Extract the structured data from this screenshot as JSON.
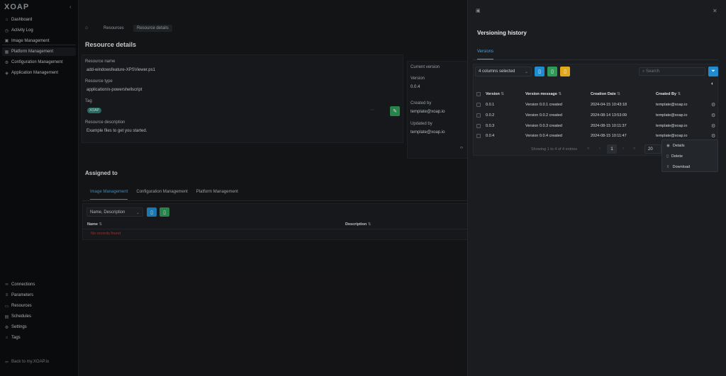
{
  "brand": {
    "logo": "XOAP"
  },
  "sidebar": {
    "items": [
      {
        "label": "Dashboard",
        "icon": "home-icon"
      },
      {
        "label": "Activity Log",
        "icon": "clock-icon"
      },
      {
        "label": "Image Management",
        "icon": "image-icon"
      },
      {
        "label": "Platform Management",
        "icon": "grid-icon"
      },
      {
        "label": "Configuration Management",
        "icon": "sliders-icon"
      },
      {
        "label": "Application Management",
        "icon": "app-icon"
      }
    ],
    "bottom": [
      {
        "label": "Connections",
        "icon": "link-icon"
      },
      {
        "label": "Parameters",
        "icon": "list-icon"
      },
      {
        "label": "Resources",
        "icon": "folder-icon"
      },
      {
        "label": "Schedules",
        "icon": "calendar-icon"
      },
      {
        "label": "Settings",
        "icon": "gear-icon"
      },
      {
        "label": "Tags",
        "icon": "tag-icon"
      }
    ],
    "back": "Back to my.XOAP.io"
  },
  "breadcrumb": {
    "items": [
      "Resources",
      "Resource details"
    ]
  },
  "details": {
    "title": "Resource details",
    "name_label": "Resource name",
    "name_value": "add-windowsfeature-XPSViewer.ps1",
    "type_label": "Resource type",
    "type_value": "application/x-powershellscript",
    "tag_label": "Tag",
    "tag_value": "XOAP",
    "desc_label": "Resource description",
    "desc_value": "Example files to get you started."
  },
  "version_card": {
    "current_label": "Current version",
    "version_label": "Version",
    "version_value": "0.0.4",
    "created_label": "Created by",
    "created_value": "template@xoap.io",
    "updated_label": "Updated by",
    "updated_value": "template@xoap.io"
  },
  "assigned": {
    "title": "Assigned to",
    "tabs": [
      "Image Management",
      "Configuration Management",
      "Platform Management"
    ],
    "columns_select": "Name, Description",
    "col_name": "Name",
    "col_desc": "Description",
    "empty": "No records found"
  },
  "drawer": {
    "title": "Versioning history",
    "tab": "Versions",
    "columns_select": "4 columns selected",
    "search_placeholder": "Search",
    "headers": [
      "Version",
      "Version message",
      "Creation Date",
      "Created By"
    ],
    "rows": [
      {
        "version": "0.0.1",
        "message": "Version 0.0.1 created",
        "date": "2024-04-15 10:43:18",
        "by": "template@xoap.io"
      },
      {
        "version": "0.0.2",
        "message": "Version 0.0.2 created",
        "date": "2024-08-14 13:53:09",
        "by": "template@xoap.io"
      },
      {
        "version": "0.0.3",
        "message": "Version 0.0.3 created",
        "date": "2024-08-15 10:11:37",
        "by": "template@xoap.io"
      },
      {
        "version": "0.0.4",
        "message": "Version 0.0.4 created",
        "date": "2024-08-15 10:11:47",
        "by": "template@xoap.io"
      }
    ],
    "pagination_text": "Showing 1 to 4 of 4 entries",
    "page": "1",
    "page_size": "20"
  },
  "context_menu": {
    "items": [
      "Details",
      "Delete",
      "Download"
    ]
  }
}
